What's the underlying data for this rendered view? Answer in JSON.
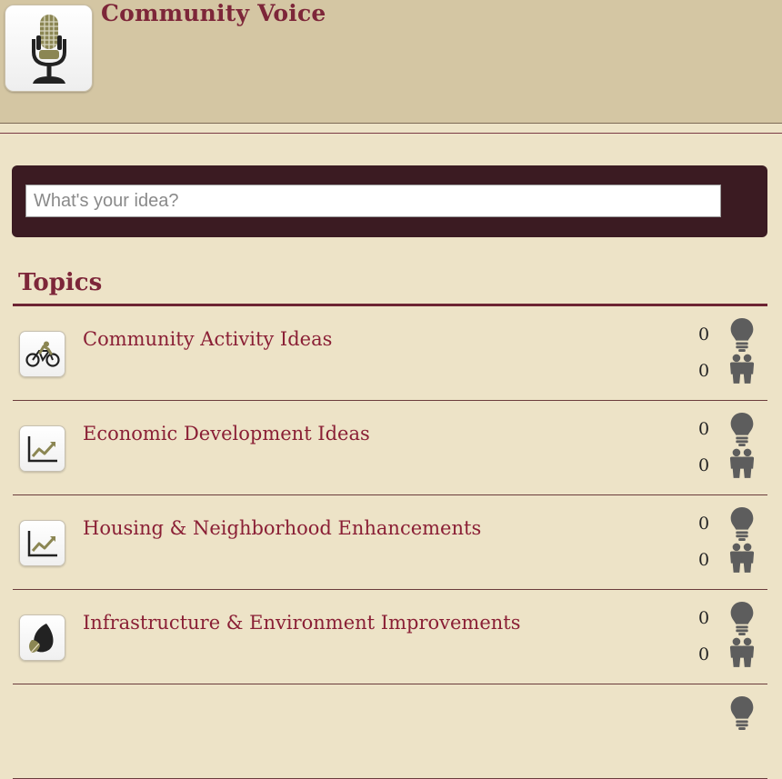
{
  "app": {
    "title": "Community Voice",
    "icon": "microphone-icon"
  },
  "search": {
    "placeholder": "What's your idea?",
    "value": ""
  },
  "topics": {
    "heading": "Topics",
    "items": [
      {
        "title": "Community Activity Ideas",
        "icon": "bicycle-icon",
        "ideas": "0",
        "participants": "0"
      },
      {
        "title": "Economic Development Ideas",
        "icon": "line-chart-icon",
        "ideas": "0",
        "participants": "0"
      },
      {
        "title": "Housing & Neighborhood Enhancements",
        "icon": "line-chart-icon",
        "ideas": "0",
        "participants": "0"
      },
      {
        "title": "Infrastructure & Environment Improvements",
        "icon": "leaf-icon",
        "ideas": "0",
        "participants": "0"
      }
    ]
  },
  "colors": {
    "background": "#ede3c7",
    "header": "#d4c6a3",
    "accent": "#7d2639",
    "search_bar": "#3b1b22"
  }
}
